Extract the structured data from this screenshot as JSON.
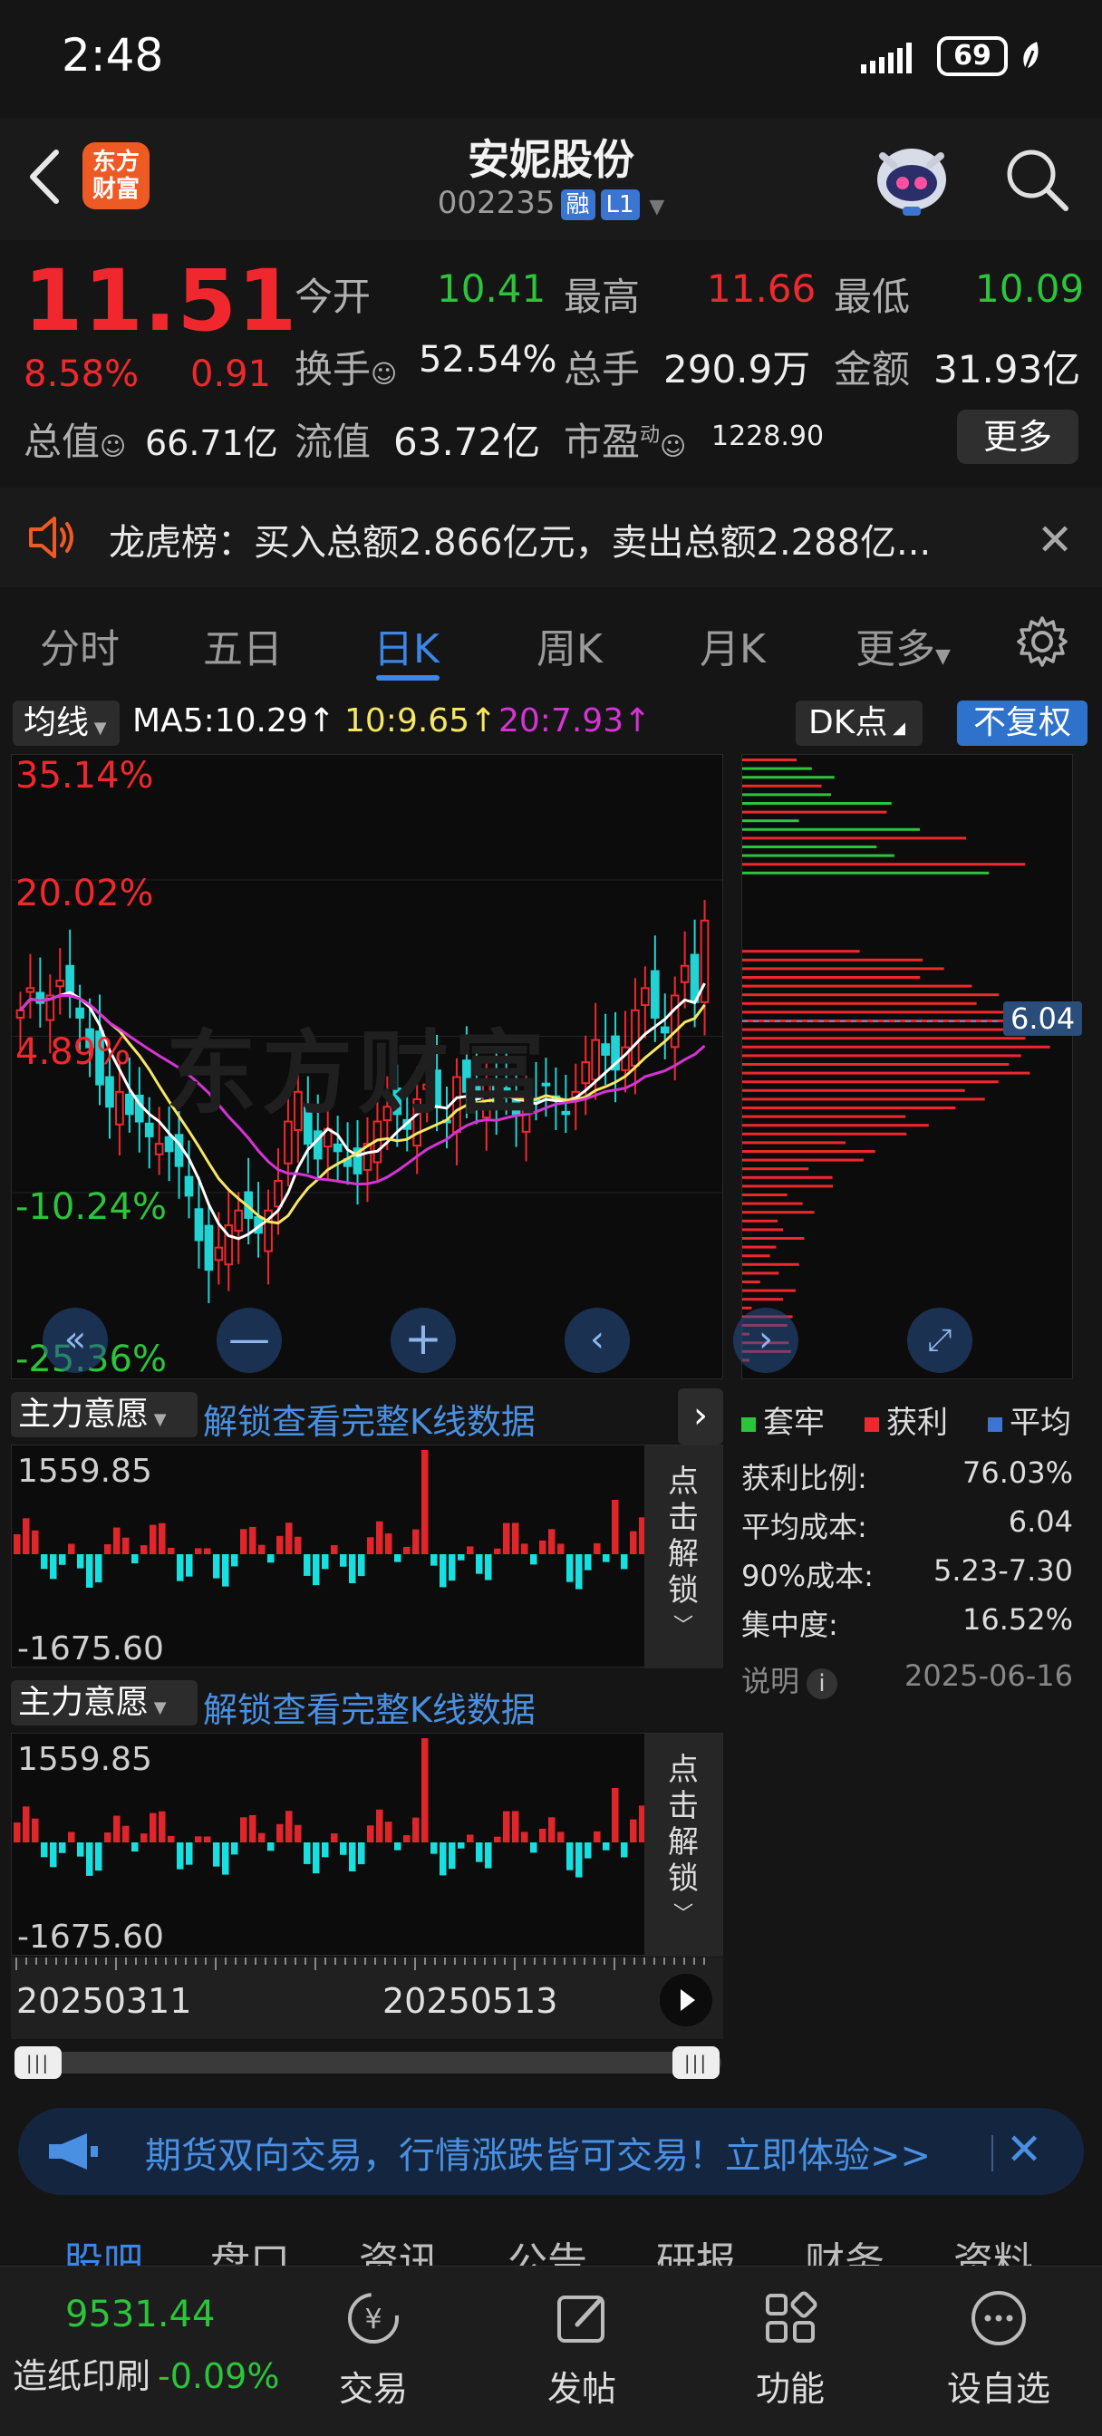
{
  "status": {
    "time": "2:48",
    "battery": "69"
  },
  "header": {
    "logo_line1": "东方",
    "logo_line2": "财富",
    "title": "安妮股份",
    "code": "002235",
    "tag1": "融",
    "tag2": "L1"
  },
  "quote": {
    "price": "11.51",
    "pct": "8.58%",
    "change": "0.91",
    "labels": {
      "open": "今开",
      "high": "最高",
      "low": "最低",
      "turnover": "换手",
      "volume": "总手",
      "amount": "金额",
      "mktcap": "总值",
      "float": "流值",
      "pe": "市盈",
      "pe_sup": "动"
    },
    "open": "10.41",
    "high": "11.66",
    "low": "10.09",
    "turnover": "52.54%",
    "volume": "290.9万",
    "amount": "31.93亿",
    "mktcap": "66.71亿",
    "float": "63.72亿",
    "pe": "1228.90",
    "more": "更多"
  },
  "notice": {
    "text": "龙虎榜：买入总额2.866亿元，卖出总额2.288亿..."
  },
  "tabs": [
    "分时",
    "五日",
    "日K",
    "周K",
    "月K",
    "更多"
  ],
  "active_tab": "日K",
  "ma": {
    "selector": "均线",
    "ma5": "MA5:10.29↑",
    "ma10": "10:9.65↑",
    "ma20": "20:7.93↑",
    "dk": "DK点",
    "adjust": "不复权",
    "colors": {
      "ma5": "#ffffff",
      "ma10": "#f5e663",
      "ma20": "#d633d6"
    }
  },
  "chart_data": {
    "type": "candlestick",
    "y_pct_labels": [
      "35.14%",
      "20.02%",
      "4.89%",
      "-10.24%",
      "-25.36%"
    ],
    "x_labels": [
      "20250311",
      "20250513"
    ],
    "closes": [
      10.3,
      10.6,
      10.4,
      10.5,
      10.7,
      10.5,
      10.2,
      9.8,
      9.3,
      9.0,
      9.2,
      8.9,
      8.8,
      8.6,
      8.5,
      8.4,
      8.2,
      7.8,
      7.2,
      6.8,
      7.1,
      7.4,
      7.6,
      7.5,
      7.3,
      7.6,
      8.0,
      8.8,
      9.2,
      8.5,
      8.3,
      8.7,
      8.4,
      8.2,
      8.1,
      8.5,
      8.8,
      9.0,
      8.9,
      8.7,
      9.1,
      9.3,
      9.0,
      8.8,
      9.4,
      9.2,
      9.1,
      9.3,
      9.0,
      9.2,
      8.9,
      9.0,
      9.1,
      9.3,
      9.1,
      8.9,
      9.2,
      9.6,
      9.9,
      9.7,
      9.5,
      9.8,
      10.3,
      10.6,
      10.2,
      10.0,
      10.5,
      10.9,
      10.41,
      11.51
    ],
    "chip_distribution": {
      "avg_cost_marker": "6.04",
      "legend": [
        "套牢",
        "获利",
        "平均"
      ]
    },
    "indicator": {
      "name": "主力意愿",
      "max": "1559.85",
      "min": "-1675.60"
    }
  },
  "panel": {
    "indicator_select": "主力意愿",
    "unlock_link": "解锁查看完整K线数据",
    "unlock_btn": "点击解锁",
    "max": "1559.85",
    "min": "-1675.60"
  },
  "chip": {
    "legend": {
      "trapped": "套牢",
      "profit": "获利",
      "avg": "平均"
    },
    "rows": [
      {
        "k": "获利比例:",
        "v": "76.03%"
      },
      {
        "k": "平均成本:",
        "v": "6.04"
      },
      {
        "k": "90%成本:",
        "v": "5.23-7.30"
      },
      {
        "k": "集中度:",
        "v": "16.52%"
      }
    ],
    "note": "说明",
    "date": "2025-06-16",
    "marker": "6.04"
  },
  "dateaxis": {
    "start": "20250311",
    "mid": "20250513"
  },
  "ad": {
    "text": "期货双向交易，行情涨跌皆可交易！立即体验>>"
  },
  "subtabs": [
    "股吧",
    "盘口",
    "资讯",
    "公告",
    "研报",
    "财务",
    "资料"
  ],
  "bottombar": {
    "index_value": "9531.44",
    "index_name": "造纸印刷",
    "index_change": "-0.09%",
    "items": [
      "交易",
      "发帖",
      "功能",
      "设自选"
    ]
  },
  "watermark": "东方财富"
}
